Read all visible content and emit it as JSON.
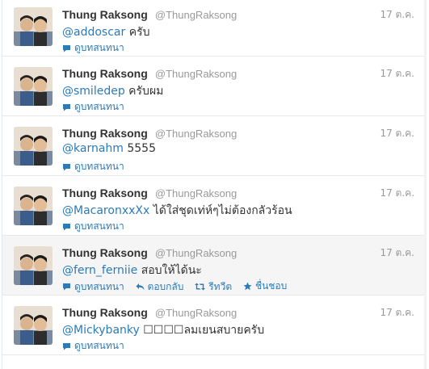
{
  "user": {
    "name": "Thung Raksong",
    "handle": "@ThungRaksong"
  },
  "colors": {
    "link": "#2b7bb9",
    "muted": "#999999",
    "hover_row": "#f5f5f5"
  },
  "tweets": [
    {
      "time": "17 ต.ค.",
      "mention": "@addoscar",
      "text": " ครับ",
      "actions": [
        "ดูบทสนทนา"
      ]
    },
    {
      "time": "17 ต.ค.",
      "mention": "@smiledep",
      "text": " ครับผม",
      "actions": [
        "ดูบทสนทนา"
      ]
    },
    {
      "time": "17 ต.ค.",
      "mention": "@karnahm",
      "text": " 5555",
      "actions": [
        "ดูบทสนทนา"
      ]
    },
    {
      "time": "17 ต.ค.",
      "mention": "@MacaronxxXx",
      "text": " ได้ใส่ชุดเท่ห์ๆไม่ต้องกลัวร้อน",
      "actions": [
        "ดูบทสนทนา"
      ]
    },
    {
      "time": "17 ต.ค.",
      "mention": "@fern_ferniie",
      "text": " สอบให้ได้นะ",
      "actions": [
        "ดูบทสนทนา",
        "ตอบกลับ",
        "รีทวีต",
        "ชื่นชอบ"
      ]
    },
    {
      "time": "17 ต.ค.",
      "mention": "@Mickybanky",
      "text": " ☐☐☐☐ลมเยนสบายครับ",
      "actions": [
        "ดูบทสนทนา"
      ]
    }
  ]
}
